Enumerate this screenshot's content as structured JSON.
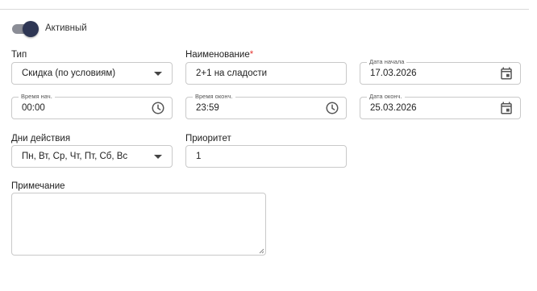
{
  "toggle": {
    "label": "Активный",
    "on": true
  },
  "fields": {
    "type": {
      "label": "Тип",
      "value": "Скидка (по условиям)"
    },
    "name": {
      "label": "Наименование",
      "required_mark": "*",
      "value": "2+1 на сладости"
    },
    "date_start": {
      "float_label": "Дата начала",
      "value": "17.03.2026",
      "icon": "calendar-icon"
    },
    "time_start": {
      "float_label": "Время нач.",
      "value": "00:00",
      "icon": "clock-icon"
    },
    "time_end": {
      "float_label": "Время оконч.",
      "value": "23:59",
      "icon": "clock-icon"
    },
    "date_end": {
      "float_label": "Дата оконч.",
      "value": "25.03.2026",
      "icon": "calendar-icon"
    },
    "days": {
      "label": "Дни действия",
      "value": "Пн, Вт, Ср, Чт, Пт, Сб, Вс"
    },
    "priority": {
      "label": "Приоритет",
      "value": "1"
    },
    "note": {
      "label": "Примечание",
      "value": ""
    }
  },
  "colors": {
    "toggle_thumb": "#2e3654",
    "toggle_track": "#8b8d96",
    "required": "#e53935",
    "border": "#c9c9c9"
  }
}
